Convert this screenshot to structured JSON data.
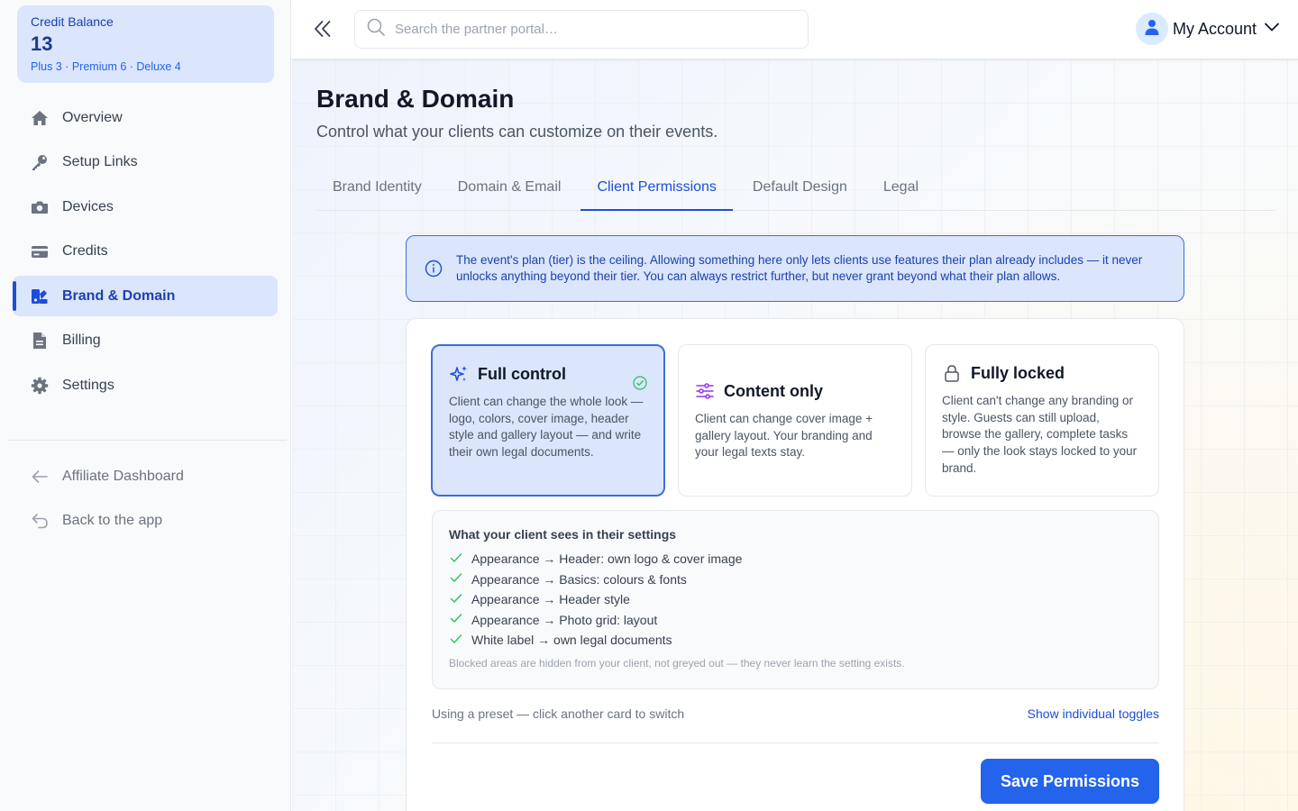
{
  "sidebar": {
    "credit": {
      "label": "Credit Balance",
      "value": "13",
      "breakdown": "Plus 3 · Premium 6 · Deluxe 4"
    },
    "items": [
      {
        "label": "Overview",
        "icon": "home-icon"
      },
      {
        "label": "Setup Links",
        "icon": "key-icon"
      },
      {
        "label": "Devices",
        "icon": "camera-icon"
      },
      {
        "label": "Credits",
        "icon": "credit-card-icon"
      },
      {
        "label": "Brand & Domain",
        "icon": "brand-icon",
        "active": true
      },
      {
        "label": "Billing",
        "icon": "document-icon"
      },
      {
        "label": "Settings",
        "icon": "gear-icon"
      }
    ],
    "secondary": [
      {
        "label": "Affiliate Dashboard",
        "icon": "arrow-left-icon"
      },
      {
        "label": "Back to the app",
        "icon": "return-icon"
      }
    ]
  },
  "topbar": {
    "search_placeholder": "Search the partner portal…",
    "account_label": "My Account"
  },
  "page": {
    "title": "Brand & Domain",
    "subtitle": "Control what your clients can customize on their events.",
    "tabs": [
      {
        "label": "Brand Identity"
      },
      {
        "label": "Domain & Email"
      },
      {
        "label": "Client Permissions",
        "active": true
      },
      {
        "label": "Default Design"
      },
      {
        "label": "Legal"
      }
    ],
    "info": "The event's plan (tier) is the ceiling. Allowing something here only lets clients use features their plan already includes — it never unlocks anything beyond their tier. You can always restrict further, but never grant beyond what their plan allows."
  },
  "presets": [
    {
      "title": "Full control",
      "icon": "sparkles-icon",
      "selected": true,
      "description": "Client can change the whole look — logo, colors, cover image, header style and gallery layout — and write their own legal documents."
    },
    {
      "title": "Content only",
      "icon": "sliders-icon",
      "selected": false,
      "description": "Client can change cover image + gallery layout. Your branding and your legal texts stay."
    },
    {
      "title": "Fully locked",
      "icon": "lock-icon",
      "selected": false,
      "description": "Client can't change any branding or style. Guests can still upload, browse the gallery, complete tasks — only the look stays locked to your brand."
    }
  ],
  "client_sees": {
    "title": "What your client sees in their settings",
    "items": [
      "Appearance → Header: own logo & cover image",
      "Appearance → Basics: colours & fonts",
      "Appearance → Header style",
      "Appearance → Photo grid: layout",
      "White label → own legal documents"
    ],
    "note": "Blocked areas are hidden from your client, not greyed out — they never learn the setting exists."
  },
  "footer": {
    "preset_text": "Using a preset — click another card to switch",
    "toggle_link": "Show individual toggles",
    "save_label": "Save Permissions"
  },
  "colors": {
    "accent": "#2463eb",
    "active_bg": "#dbe5fb",
    "check_green": "#22c55e"
  }
}
